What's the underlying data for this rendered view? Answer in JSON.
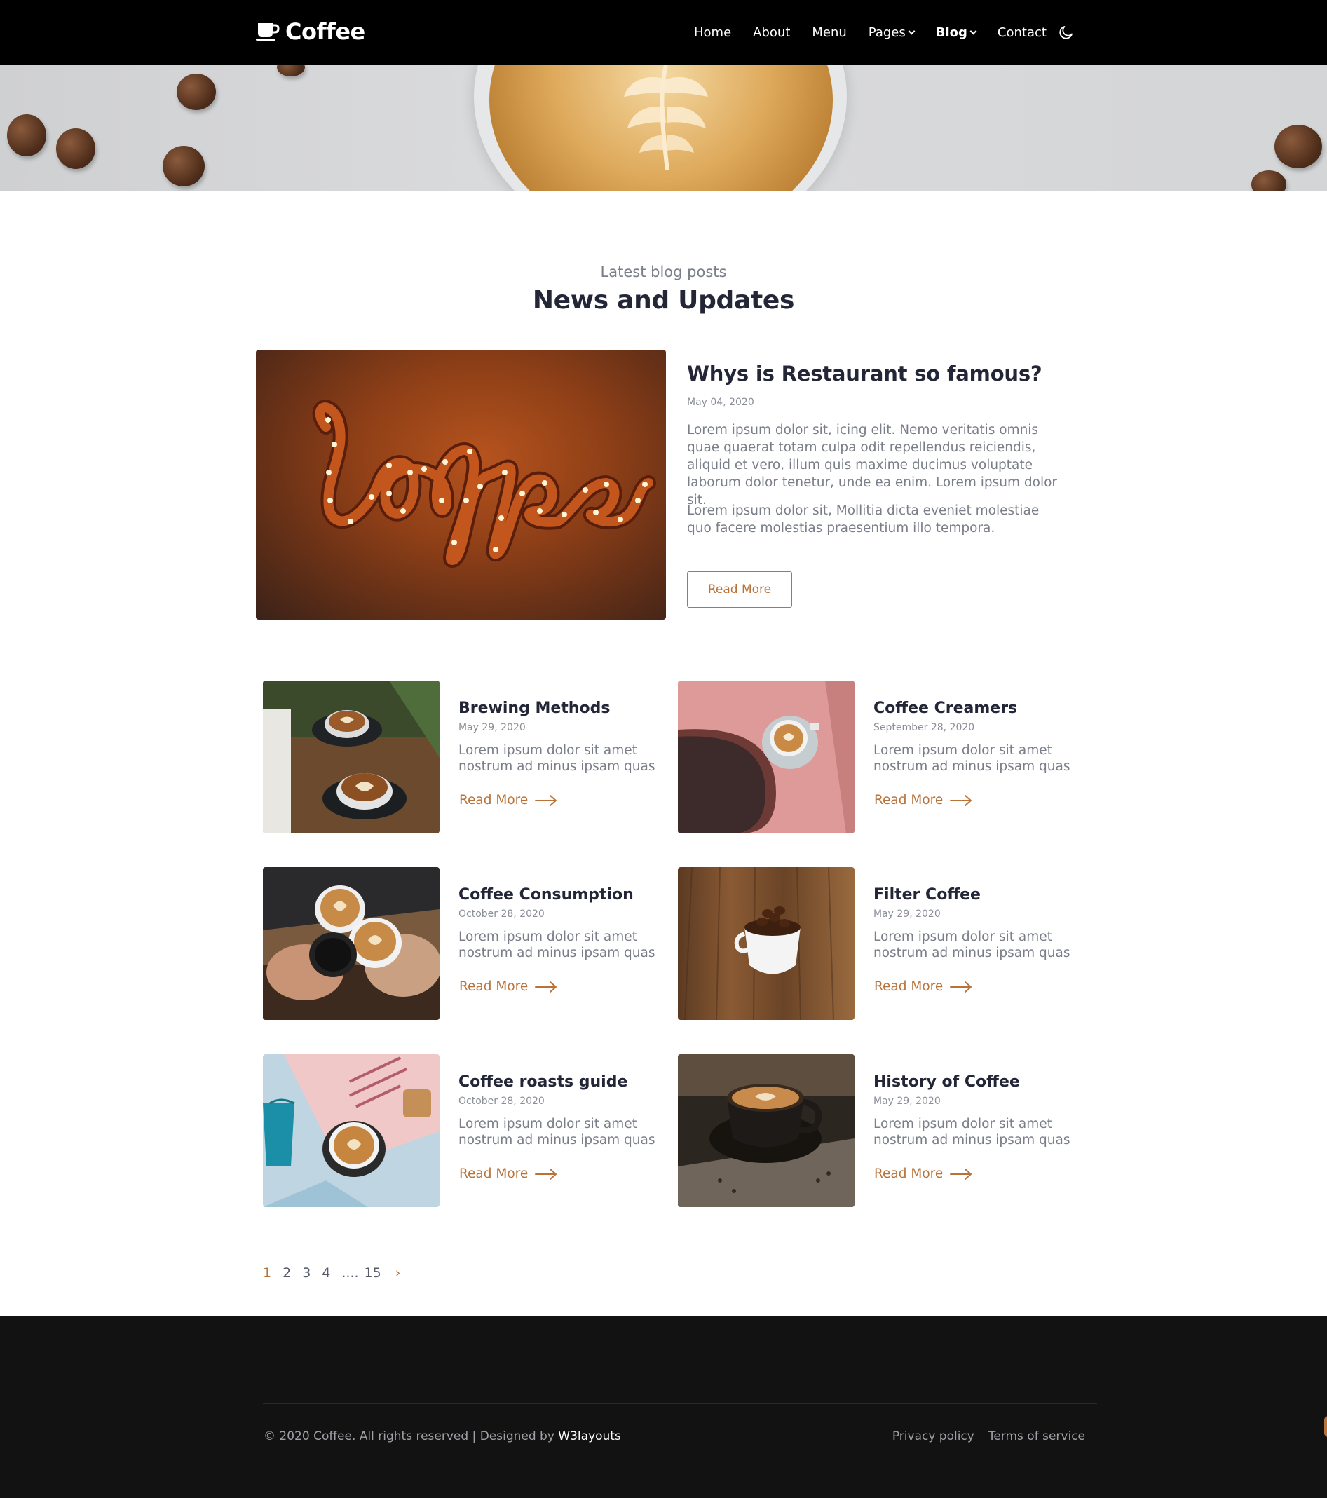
{
  "nav": {
    "brand": "Coffee",
    "links": [
      {
        "label": "Home",
        "dropdown": false,
        "active": false
      },
      {
        "label": "About",
        "dropdown": false,
        "active": false
      },
      {
        "label": "Menu",
        "dropdown": false,
        "active": false
      },
      {
        "label": "Pages",
        "dropdown": true,
        "active": false
      },
      {
        "label": "Blog",
        "dropdown": true,
        "active": true
      },
      {
        "label": "Contact",
        "dropdown": false,
        "active": false
      }
    ],
    "theme_icon": "moon-icon"
  },
  "section": {
    "subtitle": "Latest blog posts",
    "title": "News and Updates"
  },
  "featured": {
    "title": "Whys is Restaurant so famous?",
    "date": "May 04, 2020",
    "paragraph1": "Lorem ipsum dolor sit, icing elit. Nemo veritatis omnis quae quaerat totam culpa odit repellendus reiciendis, aliquid et vero, illum quis maxime ducimus voluptate laborum dolor tenetur, unde ea enim. Lorem ipsum dolor sit.",
    "paragraph2": "Lorem ipsum dolor sit, Mollitia dicta eveniet molestiae quo facere molestias praesentium illo tempora.",
    "button": "Read More"
  },
  "posts": [
    {
      "title": "Brewing Methods",
      "date": "May 29, 2020",
      "text": "Lorem ipsum dolor sit amet nostrum ad minus ipsam quas",
      "link": "Read More"
    },
    {
      "title": "Coffee Creamers",
      "date": "September 28, 2020",
      "text": "Lorem ipsum dolor sit amet nostrum ad minus ipsam quas",
      "link": "Read More"
    },
    {
      "title": "Coffee Consumption",
      "date": "October 28, 2020",
      "text": "Lorem ipsum dolor sit amet nostrum ad minus ipsam quas",
      "link": "Read More"
    },
    {
      "title": "Filter Coffee",
      "date": "May 29, 2020",
      "text": "Lorem ipsum dolor sit amet nostrum ad minus ipsam quas",
      "link": "Read More"
    },
    {
      "title": "Coffee roasts guide",
      "date": "October 28, 2020",
      "text": "Lorem ipsum dolor sit amet nostrum ad minus ipsam quas",
      "link": "Read More"
    },
    {
      "title": "History of Coffee",
      "date": "May 29, 2020",
      "text": "Lorem ipsum dolor sit amet nostrum ad minus ipsam quas",
      "link": "Read More"
    }
  ],
  "pagination": {
    "pages": [
      "1",
      "2",
      "3",
      "4"
    ],
    "current": "1",
    "ellipsis": "....",
    "last": "15",
    "next": "›"
  },
  "footer": {
    "copyright": "© 2020 Coffee. All rights reserved | Designed by ",
    "designer": "W3layouts",
    "links": [
      "Privacy policy",
      "Terms of service"
    ]
  },
  "colors": {
    "accent": "#b8733a",
    "nav_bg": "#000000",
    "footer_bg": "#121212",
    "heading": "#232637",
    "body_text": "#7a7e88"
  }
}
